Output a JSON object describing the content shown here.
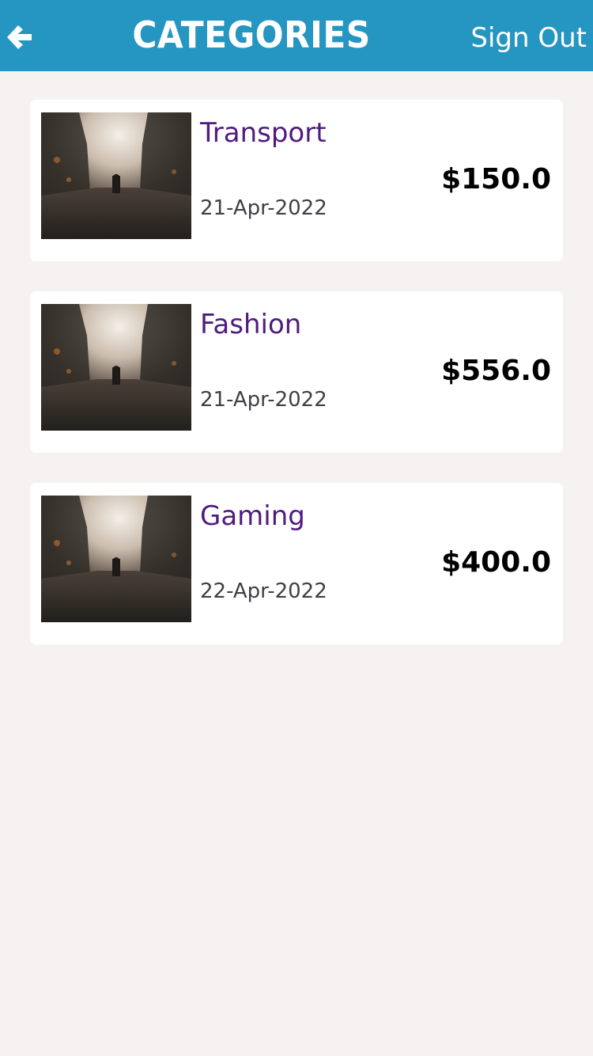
{
  "header": {
    "back_icon": "arrow-left-icon",
    "title": "CATEGORIES",
    "sign_out_label": "Sign Out",
    "background_color": "#2596c1"
  },
  "categories": [
    {
      "name": "Transport",
      "date": "21-Apr-2022",
      "amount": "$150.0",
      "thumbnail": "misty-forest-road-photo"
    },
    {
      "name": "Fashion",
      "date": "21-Apr-2022",
      "amount": "$556.0",
      "thumbnail": "misty-forest-road-photo"
    },
    {
      "name": "Gaming",
      "date": "22-Apr-2022",
      "amount": "$400.0",
      "thumbnail": "misty-forest-road-photo"
    }
  ],
  "colors": {
    "page_background": "#f6f2f1",
    "card_background": "#ffffff",
    "category_name": "#4f1b7e",
    "date_text": "#3d4147",
    "amount_text": "#000000"
  }
}
